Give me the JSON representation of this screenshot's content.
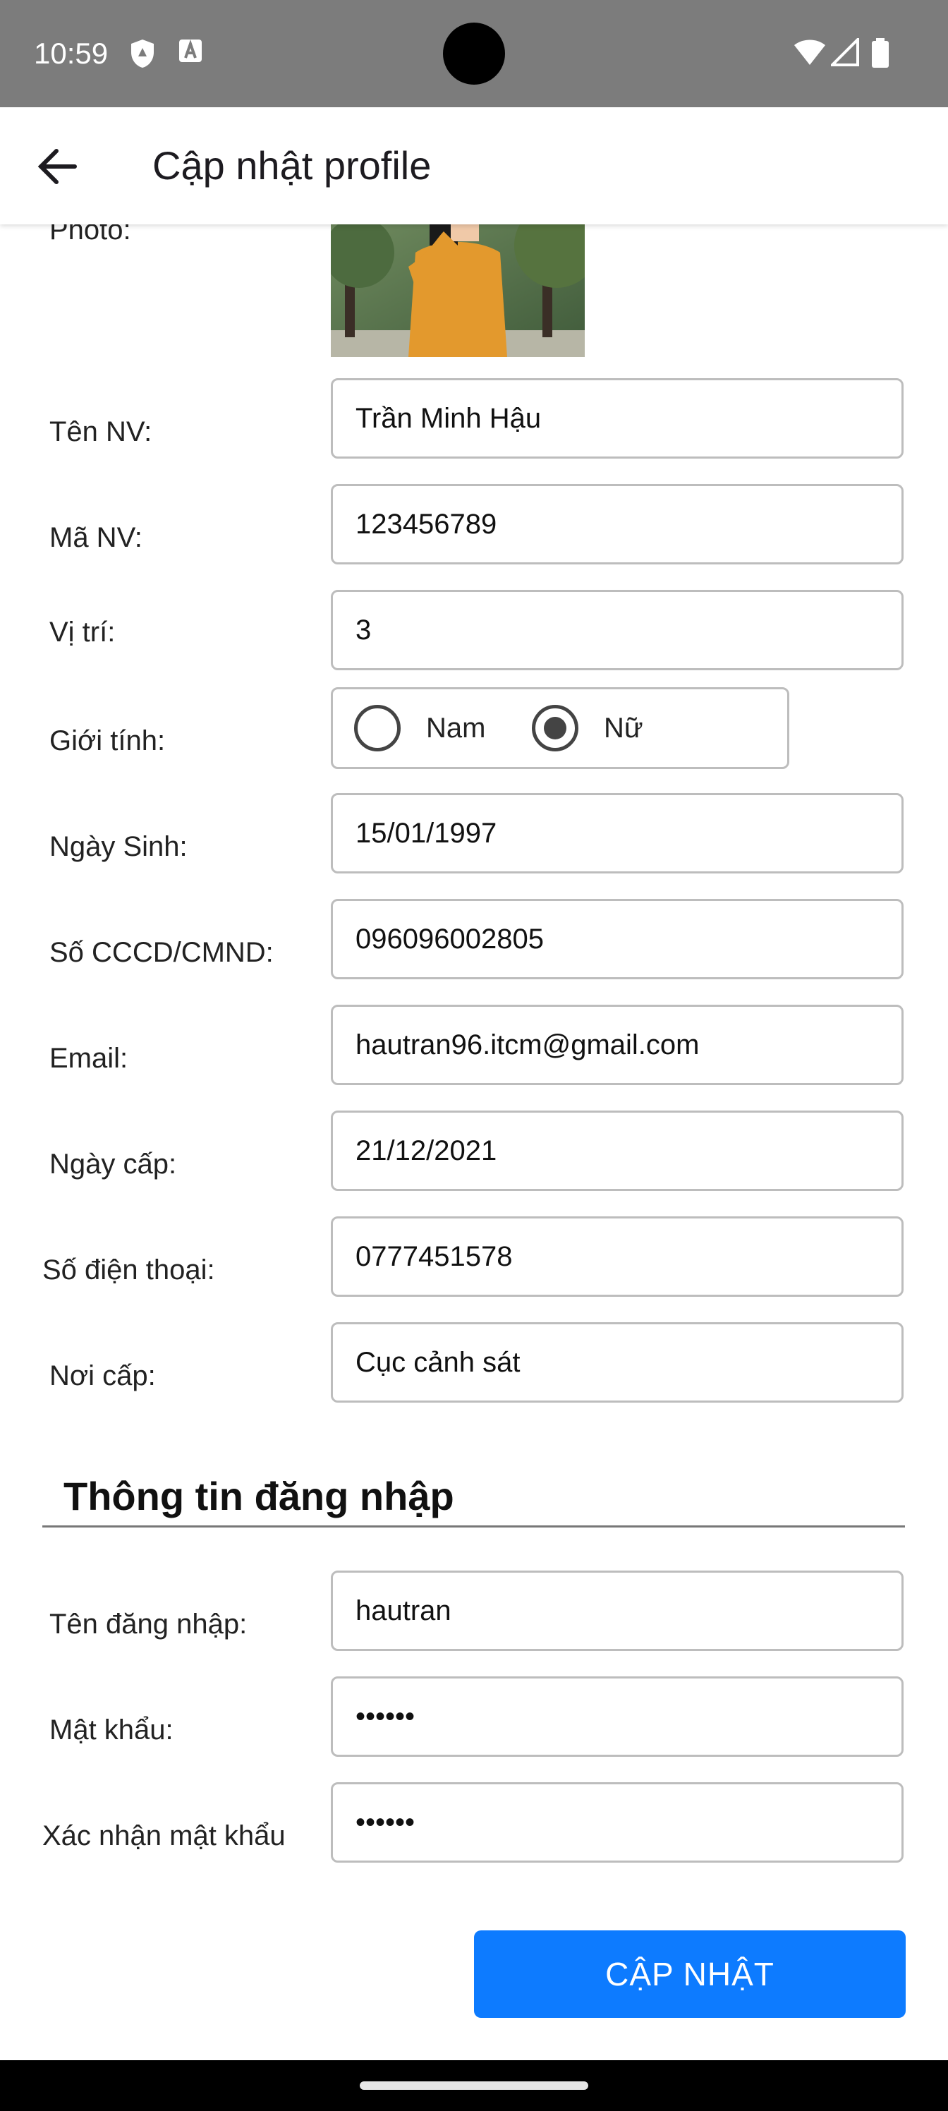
{
  "status_bar": {
    "time": "10:59"
  },
  "app_bar": {
    "title": "Cập nhật profile"
  },
  "form": {
    "photo_label": "Photo:",
    "fields": [
      {
        "label": "Tên NV:",
        "value": "Trần Minh Hậu"
      },
      {
        "label": "Mã NV:",
        "value": "123456789"
      },
      {
        "label": "Vị trí:",
        "value": "3"
      },
      {
        "label": "Ngày Sinh:",
        "value": "15/01/1997"
      },
      {
        "label": "Số CCCD/CMND:",
        "value": "096096002805"
      },
      {
        "label": "Email:",
        "value": "hautran96.itcm@gmail.com"
      },
      {
        "label": "Ngày cấp:",
        "value": "21/12/2021"
      },
      {
        "label": "Số điện thoại:",
        "value": "0777451578"
      },
      {
        "label": "Nơi cấp:",
        "value": "Cục cảnh sát"
      }
    ],
    "gender": {
      "label": "Giới tính:",
      "options": [
        "Nam",
        "Nữ"
      ],
      "selected": "Nữ"
    }
  },
  "login_section": {
    "title": "Thông tin đăng nhập",
    "fields": [
      {
        "label": "Tên đăng nhập:",
        "value": "hautran"
      },
      {
        "label": "Mật khẩu:",
        "value": "••••••"
      },
      {
        "label": "Xác nhận mật khẩu",
        "value": "••••••"
      }
    ]
  },
  "submit": {
    "label": "CẬP NHẬT"
  },
  "colors": {
    "accent": "#0d7bff",
    "status_bar": "#7c7c7c"
  }
}
